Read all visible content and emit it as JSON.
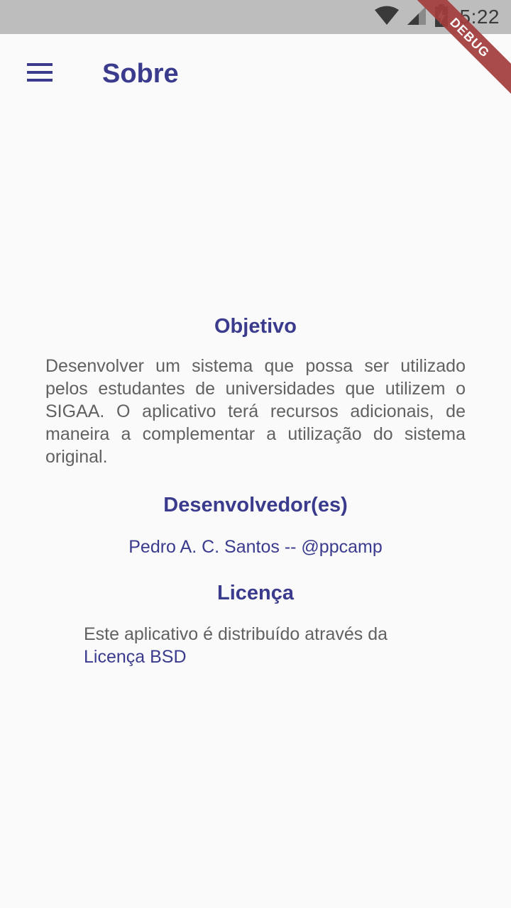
{
  "status_bar": {
    "time": "5:22",
    "icons": [
      "wifi-icon",
      "signal-icon",
      "battery-charging-icon"
    ]
  },
  "debug_banner": {
    "label": "DEBUG"
  },
  "app_bar": {
    "menu_icon": "hamburger-menu-icon",
    "title": "Sobre"
  },
  "sections": {
    "objective": {
      "heading": "Objetivo",
      "text": "Desenvolver um sistema que possa ser utilizado pelos estudantes de universidades que utilizem o SIGAA. O aplicativo terá recursos adicionais, de maneira a complementar a utilização do sistema original."
    },
    "developers": {
      "heading": "Desenvolvedor(es)",
      "name": "Pedro A. C. Santos -- @ppcamp"
    },
    "license": {
      "heading": "Licença",
      "text": "Este aplicativo é distribuído através da",
      "link": "Licença BSD"
    }
  },
  "colors": {
    "accent": "#3b3b8e",
    "body_text": "#616161",
    "status_bar": "#bdbdbd",
    "background": "#fafafa",
    "debug": "#a43d3d"
  }
}
